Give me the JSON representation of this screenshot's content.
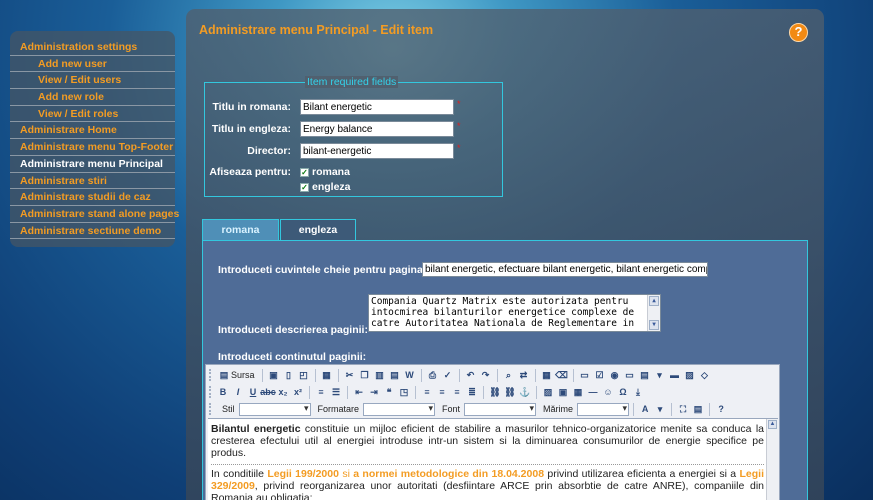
{
  "sidebar": {
    "items": [
      {
        "label": "Administration settings"
      },
      {
        "label": "Add new user"
      },
      {
        "label": "View / Edit users"
      },
      {
        "label": "Add new role"
      },
      {
        "label": "View / Edit roles"
      },
      {
        "label": "Administrare Home"
      },
      {
        "label": "Administrare menu Top-Footer"
      },
      {
        "label": "Administrare menu Principal"
      },
      {
        "label": "Administrare stiri"
      },
      {
        "label": "Administrare studii de caz"
      },
      {
        "label": "Administrare stand alone pages"
      },
      {
        "label": "Administrare sectiune demo"
      }
    ]
  },
  "main": {
    "title": "Administrare menu Principal - Edit item",
    "help": "?"
  },
  "required": {
    "legend": "Item required fields",
    "title_ro_label": "Titlu in romana:",
    "title_ro_value": "Bilant energetic",
    "title_en_label": "Titlu in engleza:",
    "title_en_value": "Energy balance",
    "director_label": "Director:",
    "director_value": "bilant-energetic",
    "display_label": "Afiseaza pentru:",
    "opt_ro": "romana",
    "opt_en": "engleza",
    "required_mark": "*"
  },
  "tabs": [
    {
      "label": "romana"
    },
    {
      "label": "engleza"
    }
  ],
  "form": {
    "keywords_label": "Introduceti cuvintele cheie pentru pagina:",
    "keywords_value": "bilant energetic, efectuare bilant energetic, bilant energetic complex",
    "description_label": "Introduceti descrierea paginii:",
    "description_value": "Compania Quartz Matrix este autorizata pentru intocmirea bilanturilor energetice complexe de catre Autoritatea Nationala de Reglementare in",
    "content_label": "Introduceti continutul paginii:"
  },
  "editor": {
    "source_label": "Sursa",
    "style_label": "Stil",
    "format_label": "Formatare",
    "font_label": "Font",
    "size_label": "Mărime",
    "p1_bold": "Bilantul energetic",
    "p1_rest": " constituie un mijloc eficient de stabilire a masurilor tehnico-organizatorice menite sa conduca la cresterea efectului util al energiei introduse intr-un sistem si la diminuarea consumurilor de energie specifice pe produs.",
    "p2_a": "In conditiile ",
    "p2_law1": "Legii 199/2000",
    "p2_si1": " si ",
    "p2_norm": "a normei metodologice din 18.04.2008",
    "p2_b": " privind utilizarea eficienta a energiei si a ",
    "p2_law2": "Legii 329/2009",
    "p2_c": ", privind reorganizarea unor autoritati (desfiintare ARCE prin absorbtie de catre ANRE), companiile din Romania au obligatia:"
  },
  "colors": {
    "accent": "#f39c23",
    "fieldset_border": "#33c7de",
    "tab_content": "#4f6c97"
  }
}
